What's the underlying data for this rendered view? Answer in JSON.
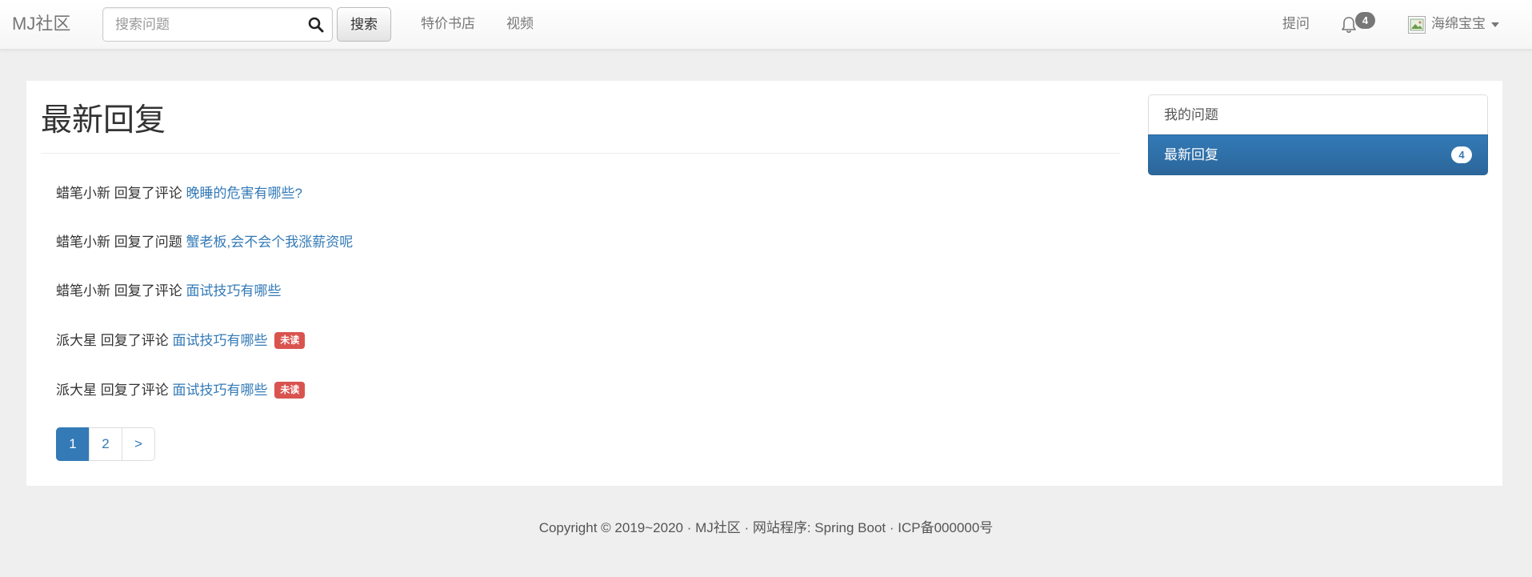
{
  "navbar": {
    "brand": "MJ社区",
    "search": {
      "placeholder": "搜索问题",
      "value": "",
      "button_label": "搜索"
    },
    "links": [
      "特价书店",
      "视频"
    ],
    "ask_label": "提问",
    "notification_count": "4",
    "user_name": "海绵宝宝"
  },
  "page": {
    "title": "最新回复"
  },
  "replies": [
    {
      "user": "蜡笔小新",
      "action": "回复了评论",
      "link": "晚睡的危害有哪些?",
      "badge": ""
    },
    {
      "user": "蜡笔小新",
      "action": "回复了问题",
      "link": "蟹老板,会不会个我涨薪资呢",
      "badge": ""
    },
    {
      "user": "蜡笔小新",
      "action": "回复了评论",
      "link": "面试技巧有哪些",
      "badge": ""
    },
    {
      "user": "派大星",
      "action": "回复了评论",
      "link": "面试技巧有哪些",
      "badge": "未读"
    },
    {
      "user": "派大星",
      "action": "回复了评论",
      "link": "面试技巧有哪些",
      "badge": "未读"
    }
  ],
  "pagination": {
    "pages": [
      "1",
      "2"
    ],
    "next": ">",
    "current": "1"
  },
  "sidebar": {
    "items": [
      {
        "label": "我的问题",
        "badge": ""
      },
      {
        "label": "最新回复",
        "badge": "4"
      }
    ]
  },
  "footer": {
    "text": "Copyright © 2019~2020 · MJ社区 · 网站程序: Spring Boot · ICP备000000号"
  },
  "colors": {
    "primary": "#337ab7",
    "danger": "#d9534f",
    "muted": "#777777",
    "background": "#efefef"
  }
}
